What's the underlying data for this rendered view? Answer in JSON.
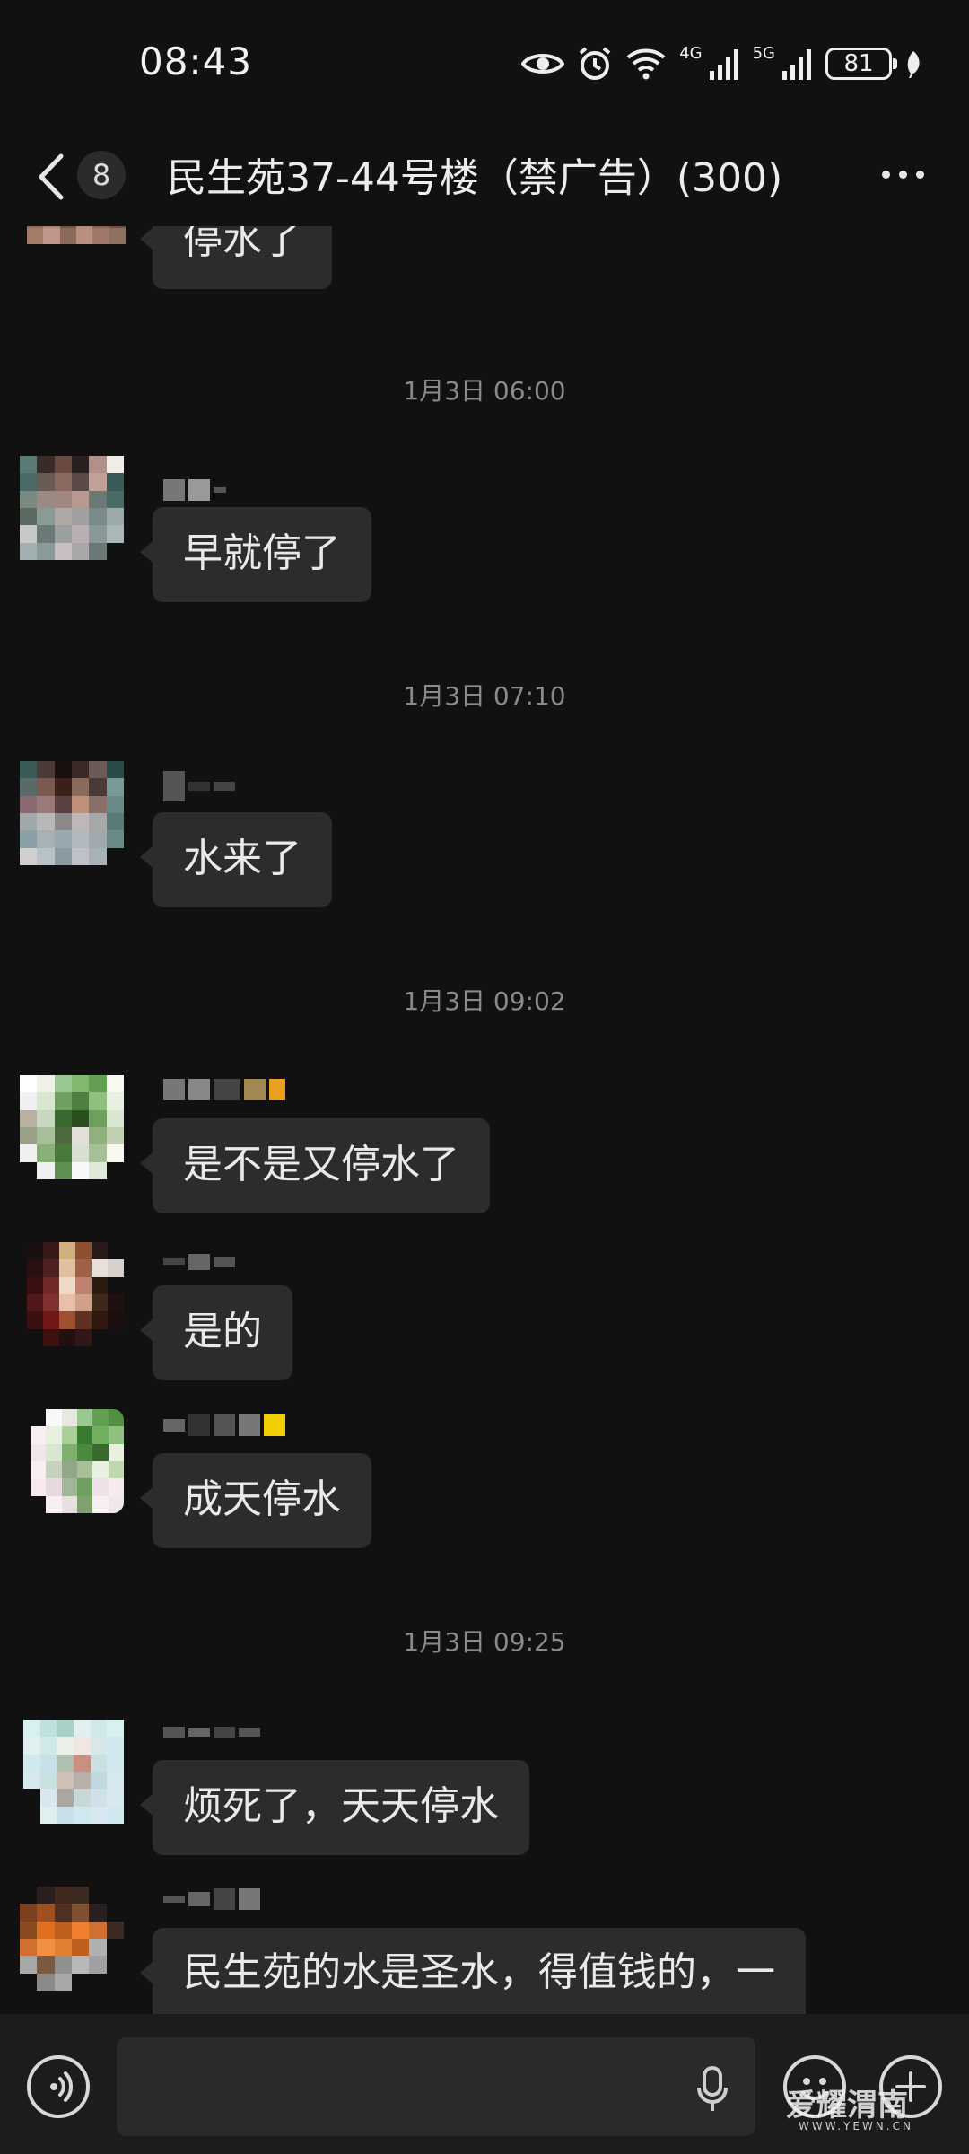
{
  "status_bar": {
    "time": "08:43",
    "signal_labels": [
      "4G",
      "5G"
    ],
    "battery": "81",
    "icons": [
      "eye-icon",
      "alarm-icon",
      "wifi-icon",
      "signal-4g-icon",
      "signal-5g-icon",
      "battery-icon",
      "leaf-icon"
    ]
  },
  "header": {
    "unread_count": "8",
    "title": "民生苑37-44号楼（禁广告）(300)"
  },
  "messages": [
    {
      "type": "text",
      "text": "停水了"
    },
    {
      "type": "time",
      "text": "1月3日 06:00"
    },
    {
      "type": "text",
      "text": "早就停了"
    },
    {
      "type": "time",
      "text": "1月3日 07:10"
    },
    {
      "type": "text",
      "text": "水来了"
    },
    {
      "type": "time",
      "text": "1月3日 09:02"
    },
    {
      "type": "text",
      "text": "是不是又停水了"
    },
    {
      "type": "text",
      "text": "是的"
    },
    {
      "type": "text",
      "text": "成天停水"
    },
    {
      "type": "time",
      "text": "1月3日 09:25"
    },
    {
      "type": "text",
      "text": "烦死了，天天停水"
    },
    {
      "type": "text",
      "text": "民生苑的水是圣水，得值钱的，一"
    }
  ],
  "input_bar": {
    "placeholder": "",
    "icons": [
      "voice-icon",
      "mic-icon",
      "emoji-icon",
      "plus-icon"
    ]
  },
  "watermark": {
    "text": "爱耀渭南",
    "sub": "WWW.YEWN.CN"
  },
  "colors": {
    "background": "#111111",
    "bubble": "#2c2c2c",
    "timestamp": "#8a8a8a",
    "input_bar": "#1c1c1c"
  }
}
